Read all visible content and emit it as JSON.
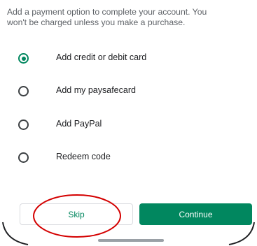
{
  "intro": {
    "line1": "Add a payment option to complete your account. You",
    "line2": "won't be charged unless you make a purchase."
  },
  "options": [
    {
      "label": "Add credit or debit card",
      "selected": true
    },
    {
      "label": "Add my paysafecard",
      "selected": false
    },
    {
      "label": "Add PayPal",
      "selected": false
    },
    {
      "label": "Redeem code",
      "selected": false
    }
  ],
  "buttons": {
    "skip_label": "Skip",
    "continue_label": "Continue"
  },
  "colors": {
    "accent": "#01875f",
    "annotation": "#d40000"
  }
}
